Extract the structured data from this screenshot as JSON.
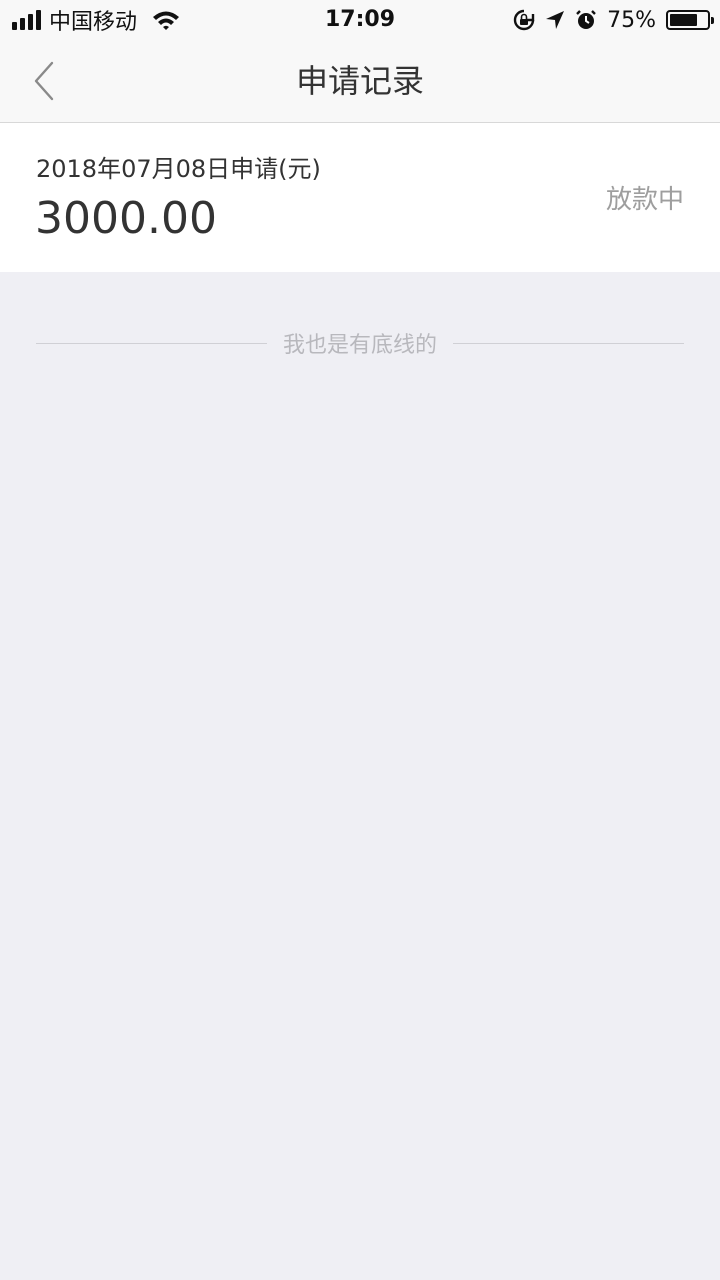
{
  "status_bar": {
    "carrier": "中国移动",
    "time": "17:09",
    "battery_percent": "75%",
    "battery_level": 0.75,
    "signal_bars": 4,
    "icons": [
      "wifi-icon",
      "rotation-lock-icon",
      "location-arrow-icon",
      "alarm-icon",
      "battery-icon"
    ]
  },
  "nav": {
    "title": "申请记录",
    "back_icon": "chevron-left-icon"
  },
  "records": [
    {
      "date_label": "2018年07月08日申请(元)",
      "amount": "3000.00",
      "status": "放款中"
    }
  ],
  "footer": {
    "end_text": "我也是有底线的"
  },
  "colors": {
    "page_background": "#efeff4",
    "card_background": "#ffffff",
    "bar_background": "#f8f8f8",
    "primary_text": "#333333",
    "status_text": "#9e9e9e",
    "hint_text": "#b8b8bd"
  }
}
